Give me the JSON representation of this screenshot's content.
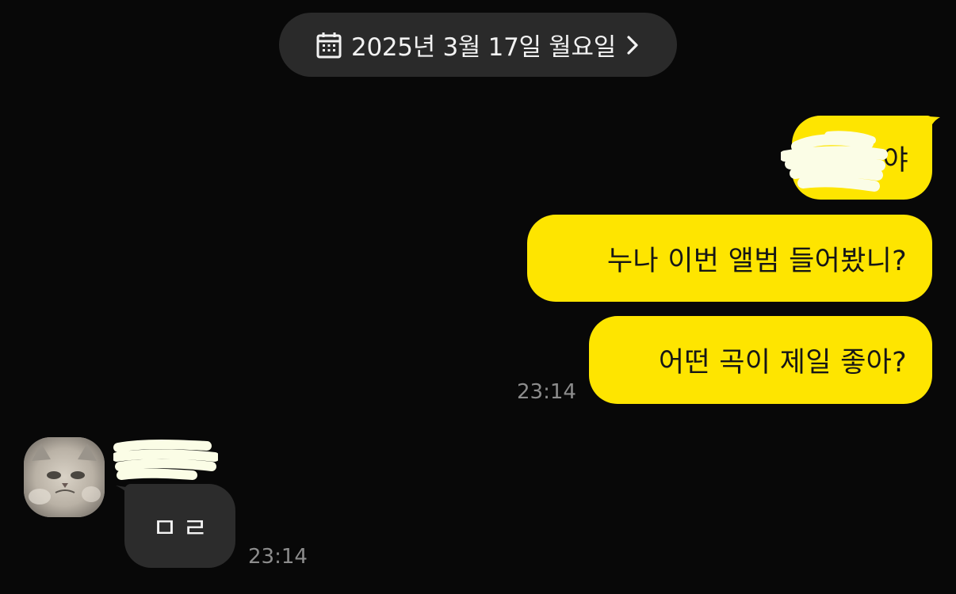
{
  "date_header": {
    "label": "2025년 3월 17일 월요일",
    "icon": "calendar-icon",
    "chevron_icon": "chevron-right-icon"
  },
  "outgoing_messages": [
    {
      "text": "야",
      "redacted_prefix": true
    },
    {
      "text": "누나 이번 앨범 들어봤니?"
    },
    {
      "text": "어떤 곡이 제일 좋아?"
    }
  ],
  "outgoing_time": "23:14",
  "incoming_message": {
    "sender_name_redacted": true,
    "text": "ㅁㄹ",
    "time": "23:14"
  },
  "colors": {
    "background": "#080808",
    "outgoing_bubble": "#fee500",
    "incoming_bubble": "#2c2c2c",
    "date_pill": "#2a2a2a",
    "timestamp": "#8c8c8c",
    "redaction": "#fbfde6"
  }
}
